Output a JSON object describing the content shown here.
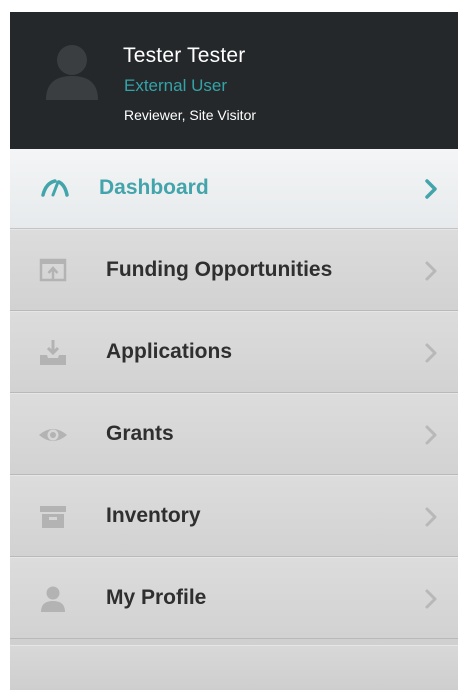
{
  "user": {
    "name": "Tester Tester",
    "type": "External User",
    "roles": "Reviewer, Site Visitor"
  },
  "menu": {
    "items": [
      {
        "label": "Dashboard",
        "icon": "dashboard-gauge-icon",
        "active": true
      },
      {
        "label": "Funding Opportunities",
        "icon": "upload-box-icon",
        "active": false
      },
      {
        "label": "Applications",
        "icon": "download-tray-icon",
        "active": false
      },
      {
        "label": "Grants",
        "icon": "eye-icon",
        "active": false
      },
      {
        "label": "Inventory",
        "icon": "archive-box-icon",
        "active": false
      },
      {
        "label": "My Profile",
        "icon": "user-icon",
        "active": false
      }
    ]
  },
  "colors": {
    "accent": "#43a5ab",
    "header_bg": "#25282b",
    "menu_bg": "#d6d6d6",
    "icon_muted": "#b3b3b3",
    "chevron_muted": "#b8b8b8"
  }
}
